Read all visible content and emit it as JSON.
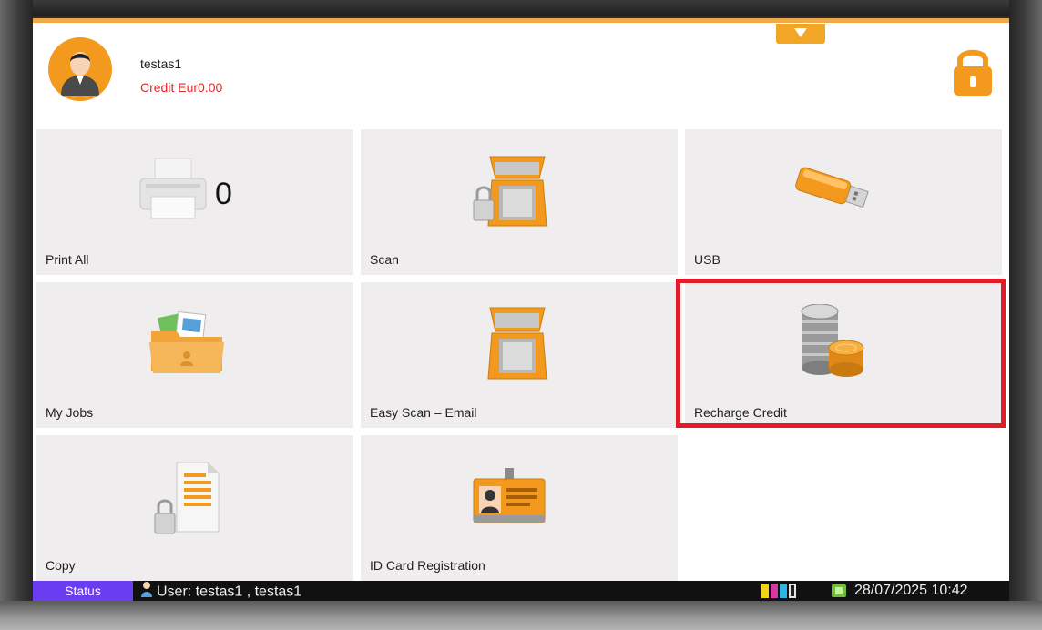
{
  "header": {
    "user_name": "testas1",
    "credit": "Credit Eur0.00",
    "avatar_icon": "user-avatar-icon",
    "dropdown_icon": "chevron-down-icon",
    "lock_icon": "lock-icon",
    "accent_color": "#f39a1e"
  },
  "tiles": [
    {
      "label": "Print All",
      "icon": "printer-icon",
      "count": "0"
    },
    {
      "label": "Scan",
      "icon": "scanner-lock-icon"
    },
    {
      "label": "USB",
      "icon": "usb-drive-icon"
    },
    {
      "label": "My Jobs",
      "icon": "folder-icon"
    },
    {
      "label": "Easy Scan – Email",
      "icon": "scanner-icon"
    },
    {
      "label": "Recharge Credit",
      "icon": "coins-icon",
      "highlighted": true
    },
    {
      "label": "Copy",
      "icon": "document-lock-icon"
    },
    {
      "label": "ID Card Registration",
      "icon": "id-card-icon"
    }
  ],
  "status_bar": {
    "status_label": "Status",
    "user_text": "User: testas1 , testas1",
    "datetime": "28/07/2025 10:42",
    "status_color": "#6b3df0"
  },
  "highlight_color": "#e01b2a"
}
